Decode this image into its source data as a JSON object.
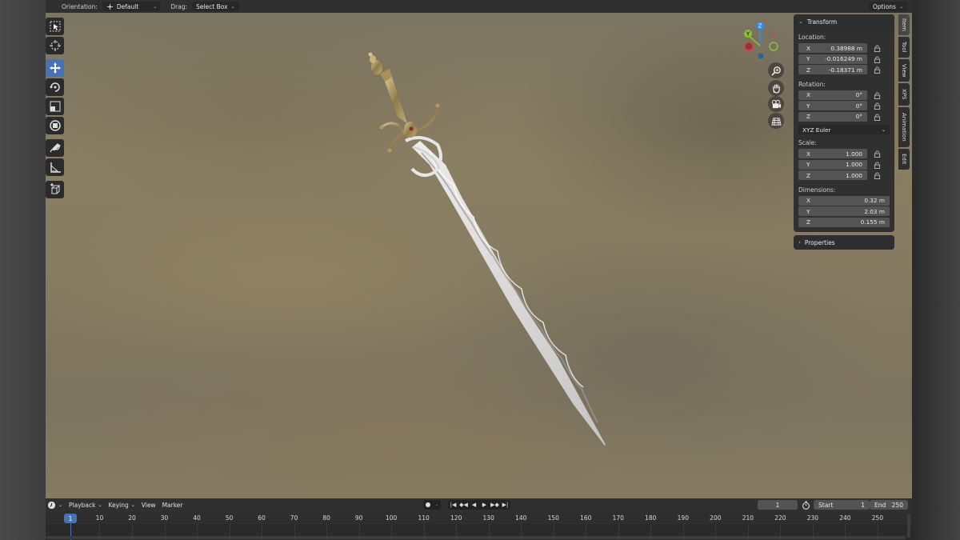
{
  "header": {
    "orientation_label": "Orientation:",
    "orientation_value": "Default",
    "drag_label": "Drag:",
    "drag_value": "Select Box",
    "options_label": "Options"
  },
  "toolbar": {
    "tools": [
      "select-box",
      "cursor",
      "move",
      "rotate",
      "scale",
      "transform",
      "annotate",
      "measure",
      "add-cube"
    ],
    "active_tool": "move",
    "accent": "#4772b3"
  },
  "gizmo": {
    "z_label": "Z",
    "y_label": "Y",
    "x_label": "X",
    "colors": {
      "x": "#e8374b",
      "y": "#8bc034",
      "z": "#2e8cf0"
    }
  },
  "transform_panel": {
    "title": "Transform",
    "location_label": "Location:",
    "location": [
      {
        "axis": "X",
        "value": "0.38988 m"
      },
      {
        "axis": "Y",
        "value": "-0.016249 m"
      },
      {
        "axis": "Z",
        "value": "-0.18371 m"
      }
    ],
    "rotation_label": "Rotation:",
    "rotation": [
      {
        "axis": "X",
        "value": "0°"
      },
      {
        "axis": "Y",
        "value": "0°"
      },
      {
        "axis": "Z",
        "value": "0°"
      }
    ],
    "rotation_mode": "XYZ Euler",
    "scale_label": "Scale:",
    "scale": [
      {
        "axis": "X",
        "value": "1.000"
      },
      {
        "axis": "Y",
        "value": "1.000"
      },
      {
        "axis": "Z",
        "value": "1.000"
      }
    ],
    "dimensions_label": "Dimensions:",
    "dimensions": [
      {
        "axis": "X",
        "value": "0.32 m"
      },
      {
        "axis": "Y",
        "value": "2.03 m"
      },
      {
        "axis": "Z",
        "value": "0.155 m"
      }
    ]
  },
  "properties_panel": {
    "title": "Properties"
  },
  "sidebar_tabs": [
    "Item",
    "Tool",
    "View",
    "XPS",
    "Animation",
    "Edit"
  ],
  "active_tab": "Item",
  "timeline": {
    "playback_label": "Playback",
    "keying_label": "Keying",
    "view_label": "View",
    "marker_label": "Marker",
    "current_frame": "1",
    "start_label": "Start",
    "start_value": "1",
    "end_label": "End",
    "end_value": "250",
    "ruler_ticks": [
      "1",
      "10",
      "20",
      "30",
      "40",
      "50",
      "60",
      "70",
      "80",
      "90",
      "100",
      "110",
      "120",
      "130",
      "140",
      "150",
      "160",
      "170",
      "180",
      "190",
      "200",
      "210",
      "220",
      "230",
      "240",
      "250"
    ]
  }
}
